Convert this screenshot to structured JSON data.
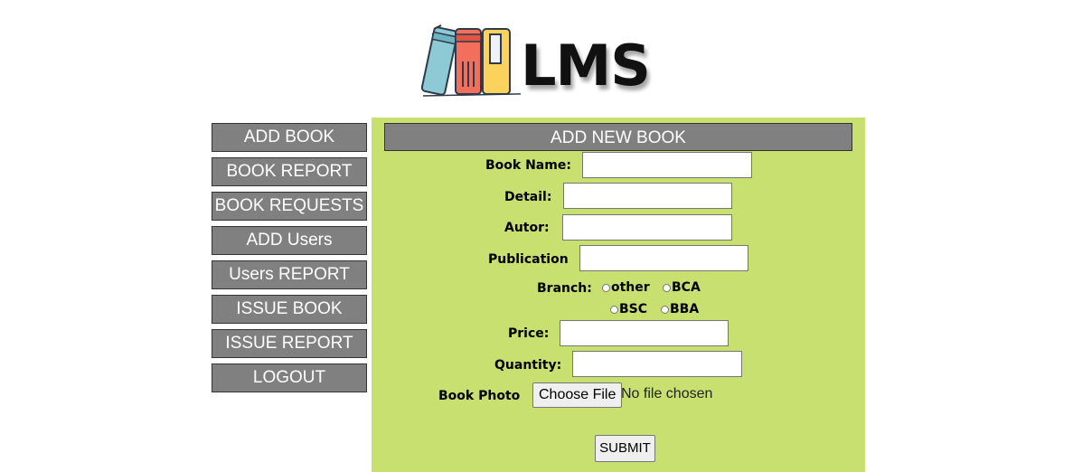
{
  "brand": {
    "logo_text": "LMS"
  },
  "sidebar": {
    "items": [
      {
        "label": "ADD BOOK"
      },
      {
        "label": "BOOK REPORT"
      },
      {
        "label": "BOOK REQUESTS"
      },
      {
        "label": "ADD Users"
      },
      {
        "label": "Users REPORT"
      },
      {
        "label": "ISSUE BOOK"
      },
      {
        "label": "ISSUE REPORT"
      },
      {
        "label": "LOGOUT"
      }
    ]
  },
  "form": {
    "title": "ADD NEW BOOK",
    "book_name": {
      "label": "Book Name:",
      "value": ""
    },
    "detail": {
      "label": "Detail:",
      "value": ""
    },
    "author": {
      "label": "Autor:",
      "value": ""
    },
    "publication": {
      "label": "Publication",
      "value": ""
    },
    "branch": {
      "label": "Branch:",
      "options": [
        "other",
        "BCA",
        "BSC",
        "BBA"
      ]
    },
    "price": {
      "label": "Price:",
      "value": ""
    },
    "quantity": {
      "label": "Quantity:",
      "value": ""
    },
    "photo": {
      "label": "Book Photo",
      "button": "Choose File",
      "status": "No file chosen"
    },
    "submit_label": "SUBMIT"
  },
  "colors": {
    "panel_bg": "#c8e070",
    "button_bg": "#808080",
    "book_blue": "#8ecad6",
    "book_red": "#f36f5c",
    "book_yellow": "#fbd35c"
  }
}
